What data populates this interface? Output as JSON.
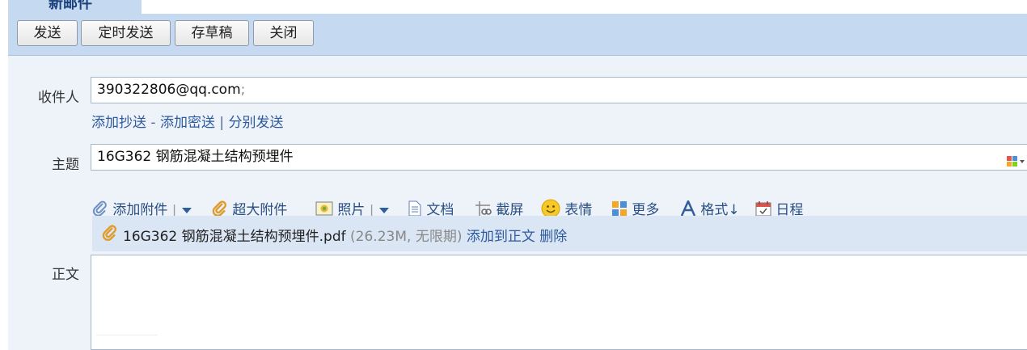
{
  "tab": {
    "title": "新邮件"
  },
  "toolbar": {
    "send": "发送",
    "scheduled_send": "定时发送",
    "save_draft": "存草稿",
    "close": "关闭"
  },
  "form": {
    "to_label": "收件人",
    "to_value": "390322806@qq.com",
    "to_separator": ";",
    "add_cc": "添加抄送",
    "dash": "-",
    "add_bcc": "添加密送",
    "pipe": "|",
    "separate_send": "分别发送",
    "subject_label": "主题",
    "subject_value": "16G362 钢筋混凝土结构预埋件",
    "body_label": "正文"
  },
  "attach_toolbar": {
    "add_attachment": "添加附件",
    "large_attachment": "超大附件",
    "photo": "照片",
    "document": "文档",
    "screenshot": "截屏",
    "emoji": "表情",
    "more": "更多",
    "format": "格式↓",
    "schedule": "日程"
  },
  "attachment": {
    "filename": "16G362 钢筋混凝土结构预埋件.pdf",
    "meta": "(26.23M, 无限期)",
    "add_to_body": "添加到正文",
    "delete": "删除"
  },
  "icons": {
    "paperclip": "paperclip-icon",
    "large_clip": "large-attachment-icon",
    "photo": "photo-icon",
    "document": "document-icon",
    "scissors": "screenshot-icon",
    "emoji": "emoji-icon",
    "more": "grid-icon",
    "format": "font-icon",
    "calendar": "calendar-icon",
    "dropdown": "chevron-down-icon"
  }
}
